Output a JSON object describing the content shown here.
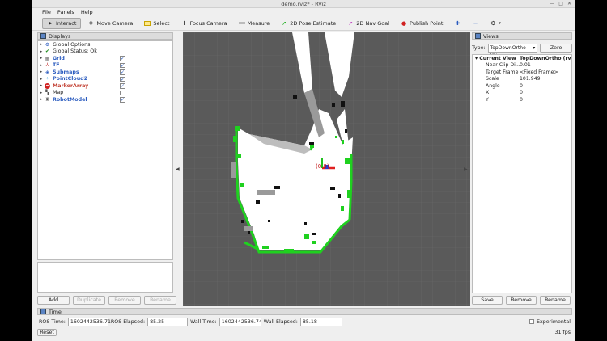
{
  "window": {
    "title": "demo.rviz* - RViz"
  },
  "menu": [
    "File",
    "Panels",
    "Help"
  ],
  "toolbar": {
    "tools": [
      {
        "label": "Interact",
        "icon": "cursor-icon",
        "active": true
      },
      {
        "label": "Move Camera",
        "icon": "move-camera-icon",
        "active": false
      },
      {
        "label": "Select",
        "icon": "select-icon",
        "active": false
      },
      {
        "label": "Focus Camera",
        "icon": "focus-camera-icon",
        "active": false
      },
      {
        "label": "Measure",
        "icon": "ruler-icon",
        "active": false
      },
      {
        "label": "2D Pose Estimate",
        "icon": "pose-estimate-arrow-icon",
        "active": false
      },
      {
        "label": "2D Nav Goal",
        "icon": "nav-goal-arrow-icon",
        "active": false
      },
      {
        "label": "Publish Point",
        "icon": "publish-point-icon",
        "active": false
      }
    ]
  },
  "displays": {
    "title": "Displays",
    "items": [
      {
        "label": "Global Options",
        "style": "normal",
        "icon": "gear-icon",
        "checkbox": null
      },
      {
        "label": "Global Status: Ok",
        "style": "normal",
        "icon": "check-icon",
        "checkbox": null
      },
      {
        "label": "Grid",
        "style": "blue",
        "icon": "grid-icon",
        "checkbox": true
      },
      {
        "label": "TF",
        "style": "blue",
        "icon": "tf-icon",
        "checkbox": true
      },
      {
        "label": "Submaps",
        "style": "blue",
        "icon": "submaps-icon",
        "checkbox": true
      },
      {
        "label": "PointCloud2",
        "style": "blue",
        "icon": "pointcloud-icon",
        "checkbox": true
      },
      {
        "label": "MarkerArray",
        "style": "red",
        "icon": "error-icon",
        "checkbox": true
      },
      {
        "label": "Map",
        "style": "normal",
        "icon": "map-icon",
        "checkbox": false
      },
      {
        "label": "RobotModel",
        "style": "blue",
        "icon": "robot-icon",
        "checkbox": true
      }
    ],
    "buttons": [
      {
        "label": "Add",
        "enabled": true
      },
      {
        "label": "Duplicate",
        "enabled": false
      },
      {
        "label": "Remove",
        "enabled": false
      },
      {
        "label": "Rename",
        "enabled": false
      }
    ]
  },
  "views": {
    "title": "Views",
    "type_label": "Type:",
    "type_value": "TopDownOrtho (rv...",
    "zero_label": "Zero",
    "header": {
      "key": "Current View",
      "value": "TopDownOrtho (rv..."
    },
    "props": [
      {
        "key": "Near Clip Di...",
        "value": "0.01"
      },
      {
        "key": "Target Frame",
        "value": "<Fixed Frame>"
      },
      {
        "key": "Scale",
        "value": "101.949"
      },
      {
        "key": "Angle",
        "value": "0"
      },
      {
        "key": "X",
        "value": "0"
      },
      {
        "key": "Y",
        "value": "0"
      }
    ],
    "buttons": [
      "Save",
      "Remove",
      "Rename"
    ]
  },
  "time": {
    "title": "Time",
    "ros_time_label": "ROS Time:",
    "ros_time": "1602442536.71",
    "ros_elapsed_label": "ROS Elapsed:",
    "ros_elapsed": "85.25",
    "wall_time_label": "Wall Time:",
    "wall_time": "1602442536.74",
    "wall_elapsed_label": "Wall Elapsed:",
    "wall_elapsed": "85.18",
    "experimental_label": "Experimental",
    "reset_label": "Reset",
    "fps": "31 fps"
  },
  "viewport": {
    "marker_label": "(0.8)"
  },
  "colors": {
    "background": "#5a5a5a",
    "free": "#ffffff",
    "wall": "#1fd11f",
    "unknown": "#8a8a8a"
  }
}
